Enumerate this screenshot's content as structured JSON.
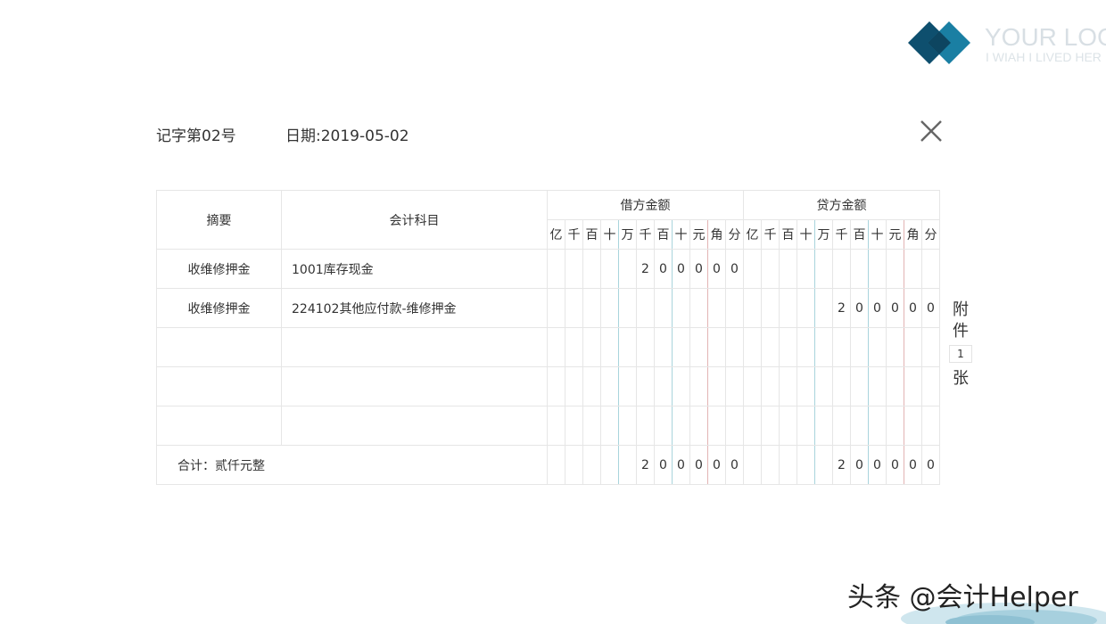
{
  "logo": {
    "title": "YOUR LOG",
    "subtitle": "I WIAH I LIVED HER"
  },
  "header": {
    "voucher_no": "记字第02号",
    "date": "日期:2019-05-02"
  },
  "table": {
    "col_summary": "摘要",
    "col_subject": "会计科目",
    "debit_header": "借方金额",
    "credit_header": "贷方金额",
    "digit_units": [
      "亿",
      "千",
      "百",
      "十",
      "万",
      "千",
      "百",
      "十",
      "元",
      "角",
      "分"
    ],
    "rows": [
      {
        "summary": "收维修押金",
        "subject": "1001库存现金",
        "debit": [
          "",
          "",
          "",
          "",
          "",
          "2",
          "0",
          "0",
          "0",
          "0",
          "0"
        ],
        "credit": [
          "",
          "",
          "",
          "",
          "",
          "",
          "",
          "",
          "",
          "",
          ""
        ]
      },
      {
        "summary": "收维修押金",
        "subject": "224102其他应付款-维修押金",
        "debit": [
          "",
          "",
          "",
          "",
          "",
          "",
          "",
          "",
          "",
          "",
          ""
        ],
        "credit": [
          "",
          "",
          "",
          "",
          "",
          "2",
          "0",
          "0",
          "0",
          "0",
          "0"
        ]
      },
      {
        "summary": "",
        "subject": "",
        "debit": [
          "",
          "",
          "",
          "",
          "",
          "",
          "",
          "",
          "",
          "",
          ""
        ],
        "credit": [
          "",
          "",
          "",
          "",
          "",
          "",
          "",
          "",
          "",
          "",
          ""
        ]
      },
      {
        "summary": "",
        "subject": "",
        "debit": [
          "",
          "",
          "",
          "",
          "",
          "",
          "",
          "",
          "",
          "",
          ""
        ],
        "credit": [
          "",
          "",
          "",
          "",
          "",
          "",
          "",
          "",
          "",
          "",
          ""
        ]
      },
      {
        "summary": "",
        "subject": "",
        "debit": [
          "",
          "",
          "",
          "",
          "",
          "",
          "",
          "",
          "",
          "",
          ""
        ],
        "credit": [
          "",
          "",
          "",
          "",
          "",
          "",
          "",
          "",
          "",
          "",
          ""
        ]
      }
    ],
    "total": {
      "label": "合计：贰仟元整",
      "debit": [
        "",
        "",
        "",
        "",
        "",
        "2",
        "0",
        "0",
        "0",
        "0",
        "0"
      ],
      "credit": [
        "",
        "",
        "",
        "",
        "",
        "2",
        "0",
        "0",
        "0",
        "0",
        "0"
      ]
    }
  },
  "attachments": {
    "label_1": "附",
    "label_2": "件",
    "count": "1",
    "unit": "张"
  },
  "watermark": "头条 @会计Helper",
  "colors": {
    "logo_dark": "#0e4f6e",
    "logo_light": "#1a7fa3",
    "separator_blue": "#a9d4dc",
    "separator_red": "#e2b4b4",
    "border": "#e6e6e6"
  }
}
